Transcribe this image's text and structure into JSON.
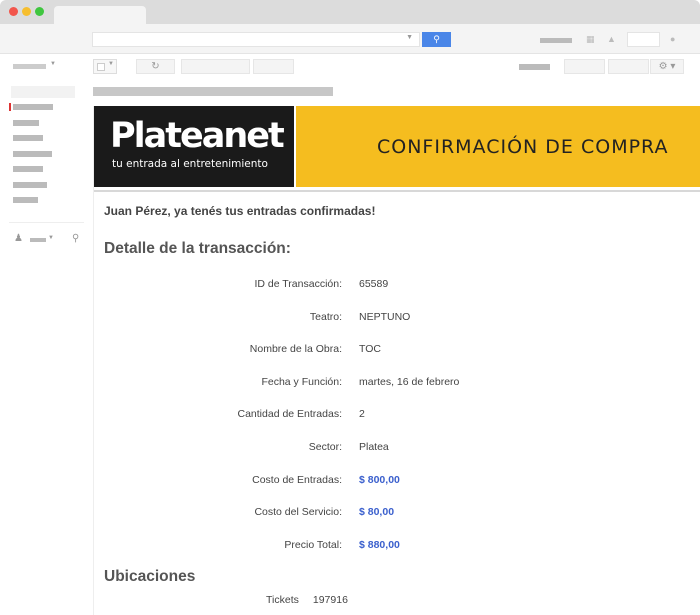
{
  "email": {
    "brand": {
      "name": "Plateanet",
      "tagline": "tu entrada al entretenimiento",
      "colors": {
        "yellow": "#f5bd1f",
        "black": "#1a1a1a",
        "link_blue": "#3a5fcd"
      }
    },
    "banner_title": "CONFIRMACIÓN DE COMPRA",
    "greeting": "Juan Pérez, ya tenés tus entradas confirmadas!",
    "detail_title": "Detalle de la transacción:",
    "details": [
      {
        "label": "ID de Transacción:",
        "value": "65589"
      },
      {
        "label": "Teatro:",
        "value": "NEPTUNO"
      },
      {
        "label": "Nombre de la Obra:",
        "value": "TOC"
      },
      {
        "label": "Fecha y Función:",
        "value": "martes, 16 de febrero"
      },
      {
        "label": "Cantidad de Entradas:",
        "value": "2"
      },
      {
        "label": "Sector:",
        "value": "Platea"
      },
      {
        "label": "Costo de Entradas:",
        "value": "$ 800,00"
      },
      {
        "label": "Costo del Servicio:",
        "value": "$ 80,00"
      },
      {
        "label": "Precio Total:",
        "value": "$ 880,00"
      }
    ],
    "locations_title": "Ubicaciones",
    "tickets": {
      "label": "Tickets",
      "value": "197916"
    }
  },
  "icons": {
    "search": "search-icon",
    "grid": "apps-grid-icon",
    "bell": "bell-icon",
    "refresh": "refresh-icon",
    "gear": "gear-icon",
    "person": "person-icon"
  }
}
